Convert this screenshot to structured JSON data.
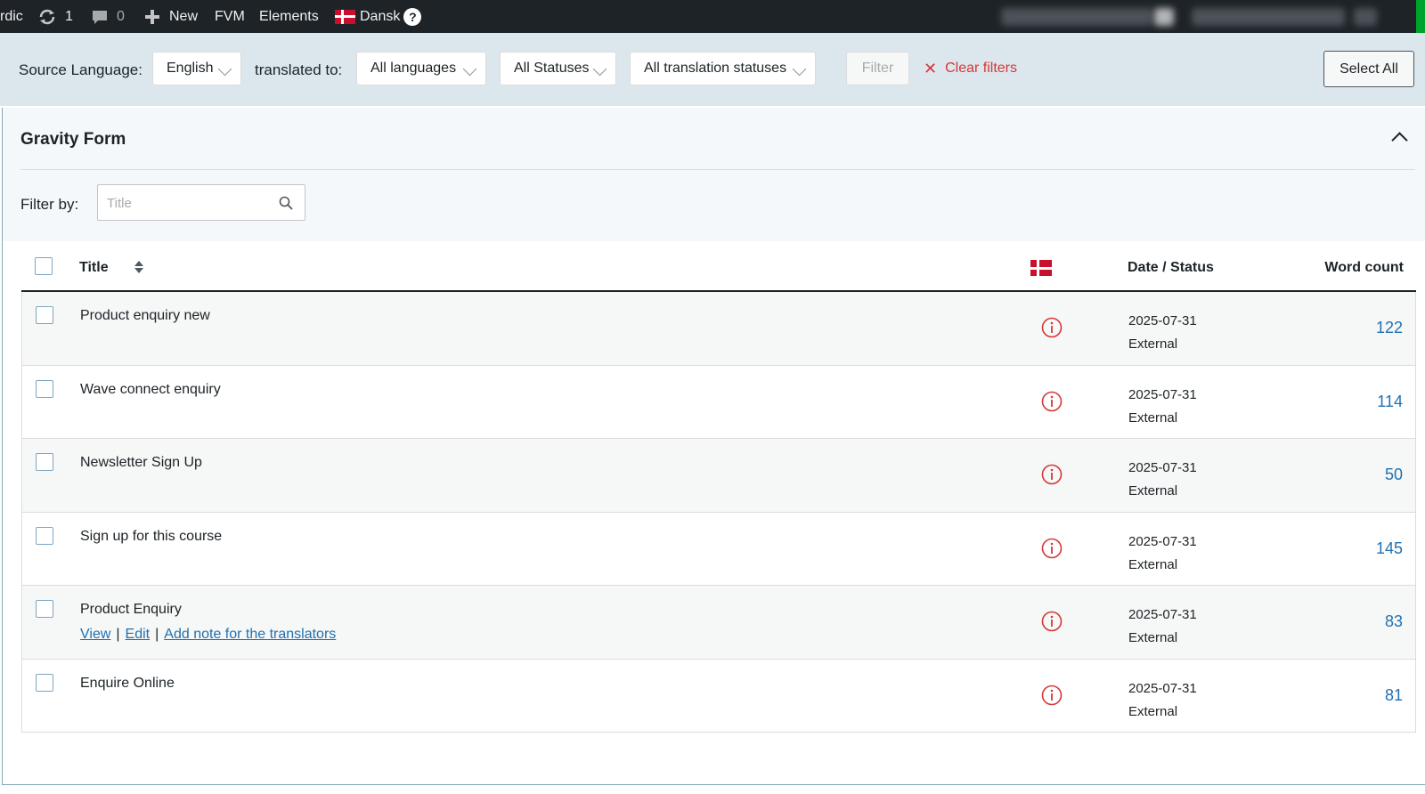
{
  "admin_bar": {
    "site_partial": "rdic",
    "updates_count": "1",
    "comments_count": "0",
    "new_label": "New",
    "fvm_label": "FVM",
    "elements_label": "Elements",
    "language_label": "Dansk",
    "help_glyph": "?"
  },
  "filters": {
    "source_language_label": "Source Language:",
    "source_language_value": "English",
    "translated_to_label": "translated to:",
    "target_language_value": "All languages",
    "status_value": "All Statuses",
    "translation_status_value": "All translation statuses",
    "filter_button": "Filter",
    "clear_filters": "Clear filters",
    "select_all": "Select All"
  },
  "panel": {
    "title": "Gravity Form",
    "filter_by_label": "Filter by:",
    "search_placeholder": "Title"
  },
  "table": {
    "columns": {
      "title": "Title",
      "date_status": "Date / Status",
      "word_count": "Word count"
    },
    "rows": [
      {
        "title": "Product enquiry new",
        "date": "2025-07-31",
        "status": "External",
        "word_count": "122"
      },
      {
        "title": "Wave connect enquiry",
        "date": "2025-07-31",
        "status": "External",
        "word_count": "114"
      },
      {
        "title": "Newsletter Sign Up",
        "date": "2025-07-31",
        "status": "External",
        "word_count": "50"
      },
      {
        "title": "Sign up for this course",
        "date": "2025-07-31",
        "status": "External",
        "word_count": "145"
      },
      {
        "title": "Product Enquiry",
        "date": "2025-07-31",
        "status": "External",
        "word_count": "83",
        "actions": {
          "view": "View",
          "edit": "Edit",
          "note": "Add note for the translators"
        }
      },
      {
        "title": "Enquire Online",
        "date": "2025-07-31",
        "status": "External",
        "word_count": "81"
      }
    ]
  },
  "colors": {
    "admin_bar": "#1d2327",
    "filter_bar": "#dce7ed",
    "link": "#2271b1",
    "danger": "#d63638",
    "flag_red": "#c8102e"
  },
  "icons": {
    "updates": "refresh-icon",
    "comments": "comment-bubble-icon",
    "new": "plus-icon",
    "language_flag": "danish-flag-icon",
    "help": "help-icon",
    "search": "search-icon",
    "sort": "sort-icon",
    "collapse": "chevron-up-icon",
    "status": "info-circle-icon"
  }
}
